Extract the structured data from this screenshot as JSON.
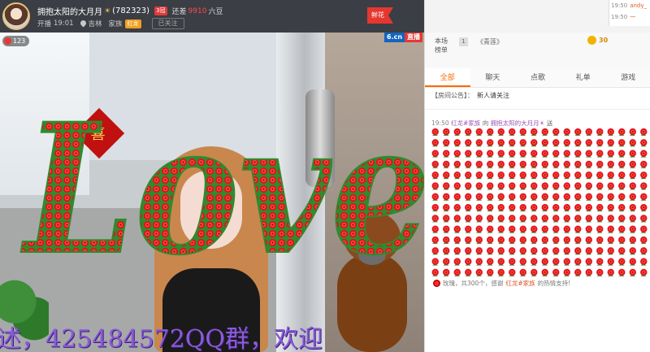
{
  "anchor": {
    "name": "拥抱太阳的大月月",
    "name_star": "☀",
    "room_id": "(782323)",
    "rank_badge": "3冠",
    "gap_label": "还差",
    "gap_value": "9910",
    "gap_unit": "六豆",
    "start_label": "开播",
    "start_time": "19:01",
    "location": "吉林",
    "family_label": "家族",
    "family_badge": "红龙",
    "follow_label": "已关注",
    "gift_flag": "鲜花"
  },
  "video": {
    "viewer_count": "123",
    "brand": "6.cn",
    "live_label": "直播",
    "overlay_word": "Love",
    "scroll_text": "述，425484572QQ群，欢迎"
  },
  "mini_chat": [
    {
      "time": "19:50",
      "user": "andy_"
    },
    {
      "time": "19:50",
      "user": "一"
    }
  ],
  "rank": {
    "label_line1": "本场",
    "label_line2": "榜单",
    "position": "1",
    "user": "《青莲》",
    "score": "30"
  },
  "tabs": [
    "全部",
    "聊天",
    "点歌",
    "礼单",
    "游戏"
  ],
  "active_tab": "全部",
  "announcement": {
    "label": "【房间公告】：",
    "text": "新人请关注"
  },
  "gift_message": {
    "time": "19:50",
    "sender": "红龙#家族",
    "verb": "向",
    "receiver": "拥抱太阳的大月月☀",
    "action": "送"
  },
  "gift_summary": {
    "prefix": "玫瑰，共300个，感谢",
    "who": "红龙#家族",
    "suffix": "的热情支持!"
  },
  "colors": {
    "accent": "#ff6a00",
    "rose": "#e0141e",
    "leaf": "#2e8b2e",
    "bar": "#3b3e44"
  }
}
